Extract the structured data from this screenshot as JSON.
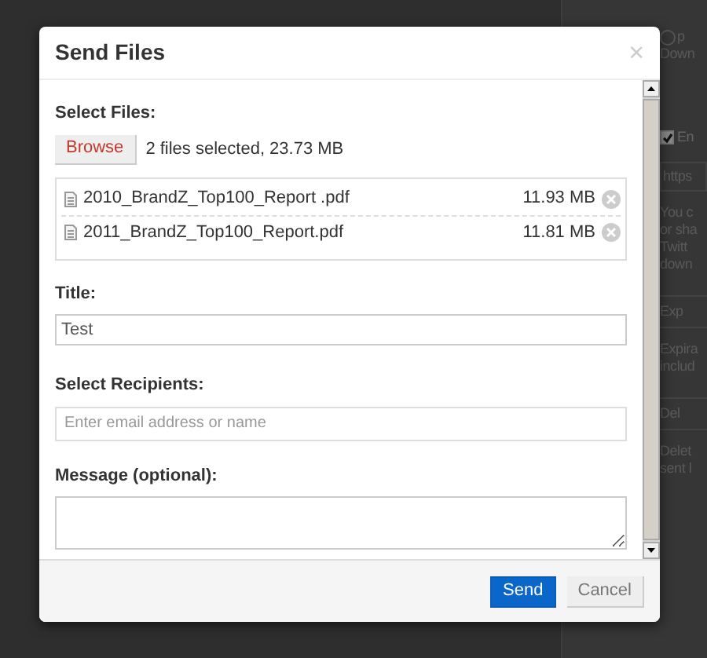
{
  "background": {
    "texts": [
      {
        "kind": "user",
        "text": "p"
      },
      {
        "kind": "line",
        "text": "Down"
      },
      {
        "kind": "check",
        "text": "En",
        "checked": true
      },
      {
        "kind": "field",
        "text": "https"
      },
      {
        "kind": "para",
        "lines": [
          "You c",
          "or sha",
          "Twitt",
          "down"
        ]
      },
      {
        "kind": "tab",
        "text": "Exp"
      },
      {
        "kind": "para",
        "lines": [
          "Expira",
          "includ"
        ]
      },
      {
        "kind": "tab",
        "text": "Del"
      },
      {
        "kind": "para",
        "lines": [
          "Delet",
          "sent l"
        ]
      }
    ]
  },
  "dialog": {
    "title": "Send Files",
    "close": "×",
    "files": {
      "label": "Select Files:",
      "browse": "Browse",
      "summary": "2 files selected, 23.73 MB",
      "items": [
        {
          "name": "2010_BrandZ_Top100_Report .pdf",
          "size": "11.93 MB"
        },
        {
          "name": "2011_BrandZ_Top100_Report.pdf",
          "size": "11.81 MB"
        }
      ]
    },
    "title_field": {
      "label": "Title:",
      "value": "Test"
    },
    "recipients": {
      "label": "Select Recipients:",
      "placeholder": "Enter email address or name"
    },
    "message": {
      "label": "Message (optional):"
    },
    "buttons": [
      {
        "kind": "primary",
        "label": "Send"
      },
      {
        "kind": "secondary",
        "label": "Cancel"
      }
    ]
  }
}
